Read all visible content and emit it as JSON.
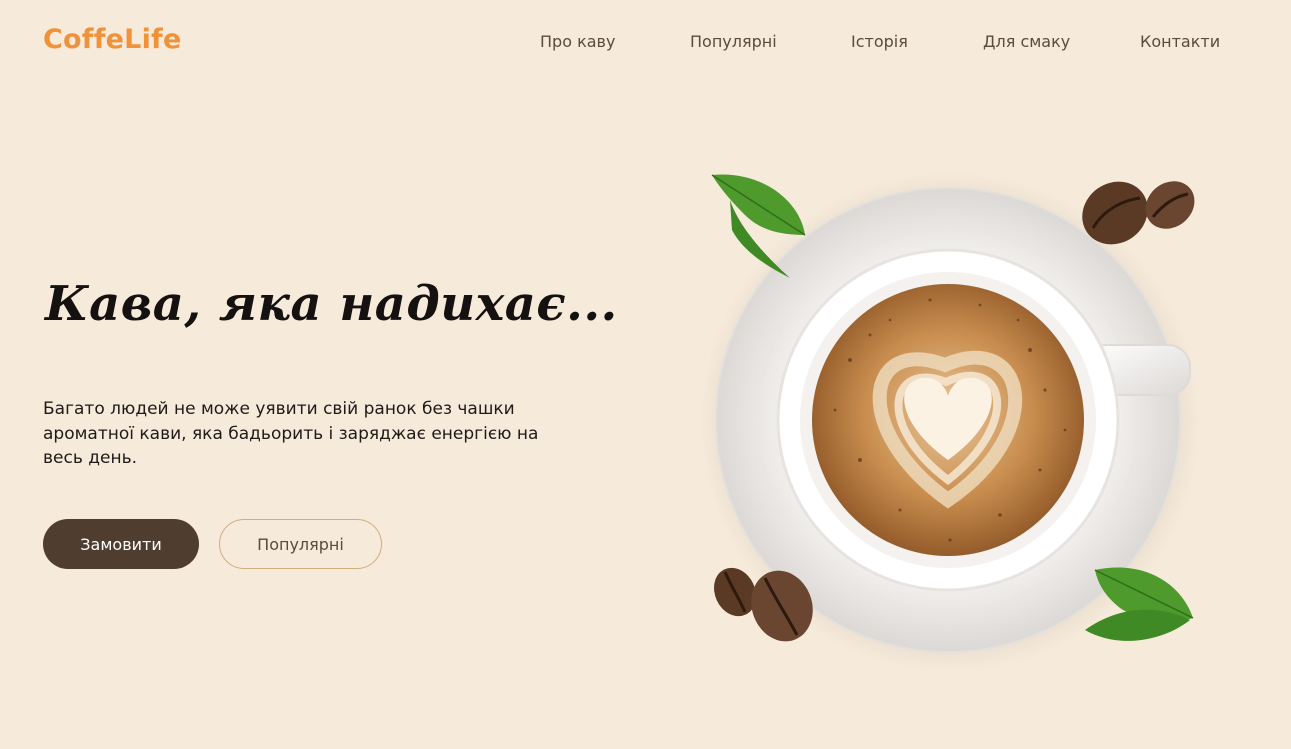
{
  "header": {
    "logo": "CoffeLife",
    "nav": [
      "Про каву",
      "Популярні",
      "Історія",
      "Для смаку",
      "Контакти"
    ]
  },
  "hero": {
    "title": "Кава, яка надихає...",
    "description": "Багато людей не може уявити свій ранок без чашки ароматної кави, яка бадьорить і заряджає енергією на весь день.",
    "primary_button": "Замовити",
    "secondary_button": "Популярні"
  },
  "colors": {
    "background": "#f6eadb",
    "logo": "#f0923a",
    "primary_button": "#4f3d2f",
    "secondary_button_border": "#cfae7e"
  },
  "image": {
    "icons": [
      "coffee-cup-illustration",
      "coffee-bean-icon",
      "coffee-leaf-icon"
    ]
  }
}
